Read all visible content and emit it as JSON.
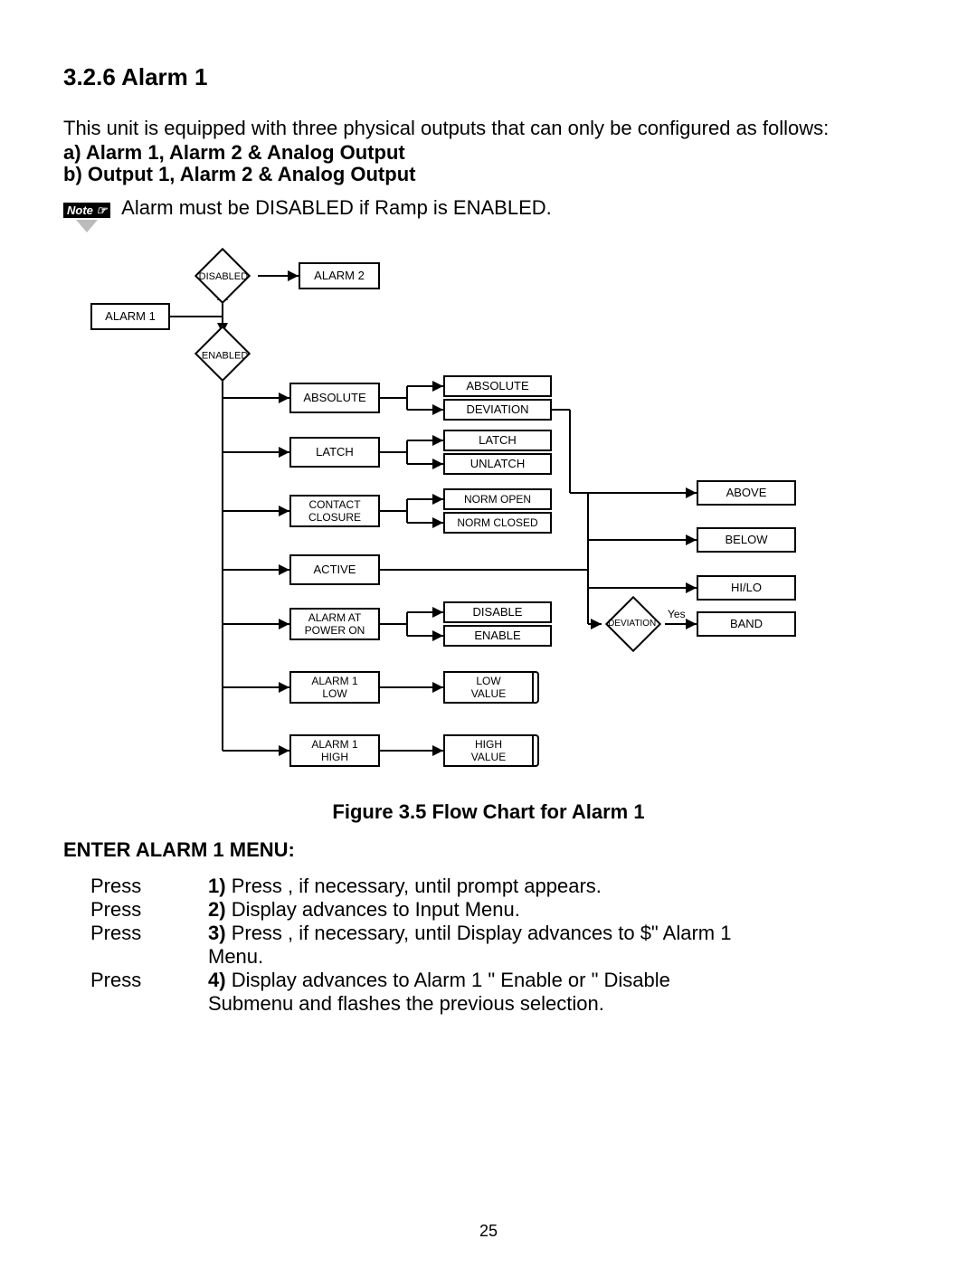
{
  "section_heading": "3.2.6 Alarm 1",
  "intro": "This unit is equipped with three physical outputs that can only be configured as follows:",
  "options": {
    "a": "a)   Alarm 1, Alarm 2 & Analog Output",
    "b": "b)   Output 1, Alarm 2 & Analog Output"
  },
  "note_label": "Note ☞",
  "note_text": "Alarm must be DISABLED if Ramp is ENABLED.",
  "figure_caption": "Figure 3.5 Flow Chart for Alarm 1",
  "enter_heading": "ENTER ALARM 1 MENU:",
  "press_label": "Press",
  "steps": {
    "s1": "Press    , if necessary, until            prompt appears.",
    "s2": "Display advances to            Input Menu.",
    "s3a": "Press    , if necessary, until Display advances to $\"        Alarm 1",
    "s3b": "Menu.",
    "s4a": "Display advances to Alarm 1    \"        Enable or    \"        Disable",
    "s4b": "Submenu and flashes the previous selection."
  },
  "page_number": "25",
  "nodes": {
    "alarm1": "ALARM 1",
    "disabled": "DISABLED",
    "enabled": "ENABLED",
    "alarm2": "ALARM 2",
    "absolute": "ABSOLUTE",
    "latch": "LATCH",
    "contact_closure": "CONTACT\nCLOSURE",
    "active": "ACTIVE",
    "alarm_at_power_on": "ALARM AT\nPOWER ON",
    "alarm1_low": "ALARM 1\nLOW",
    "alarm1_high": "ALARM 1\nHIGH",
    "absolute2": "ABSOLUTE",
    "deviation": "DEVIATION",
    "latch2": "LATCH",
    "unlatch": "UNLATCH",
    "norm_open": "NORM OPEN",
    "norm_closed": "NORM CLOSED",
    "disable": "DISABLE",
    "enable": "ENABLE",
    "low_value": "LOW\nVALUE",
    "high_value": "HIGH\nVALUE",
    "above": "ABOVE",
    "below": "BELOW",
    "hilo": "HI/LO",
    "band": "BAND",
    "dev_diamond": "DEVIATION",
    "yes": "Yes"
  }
}
